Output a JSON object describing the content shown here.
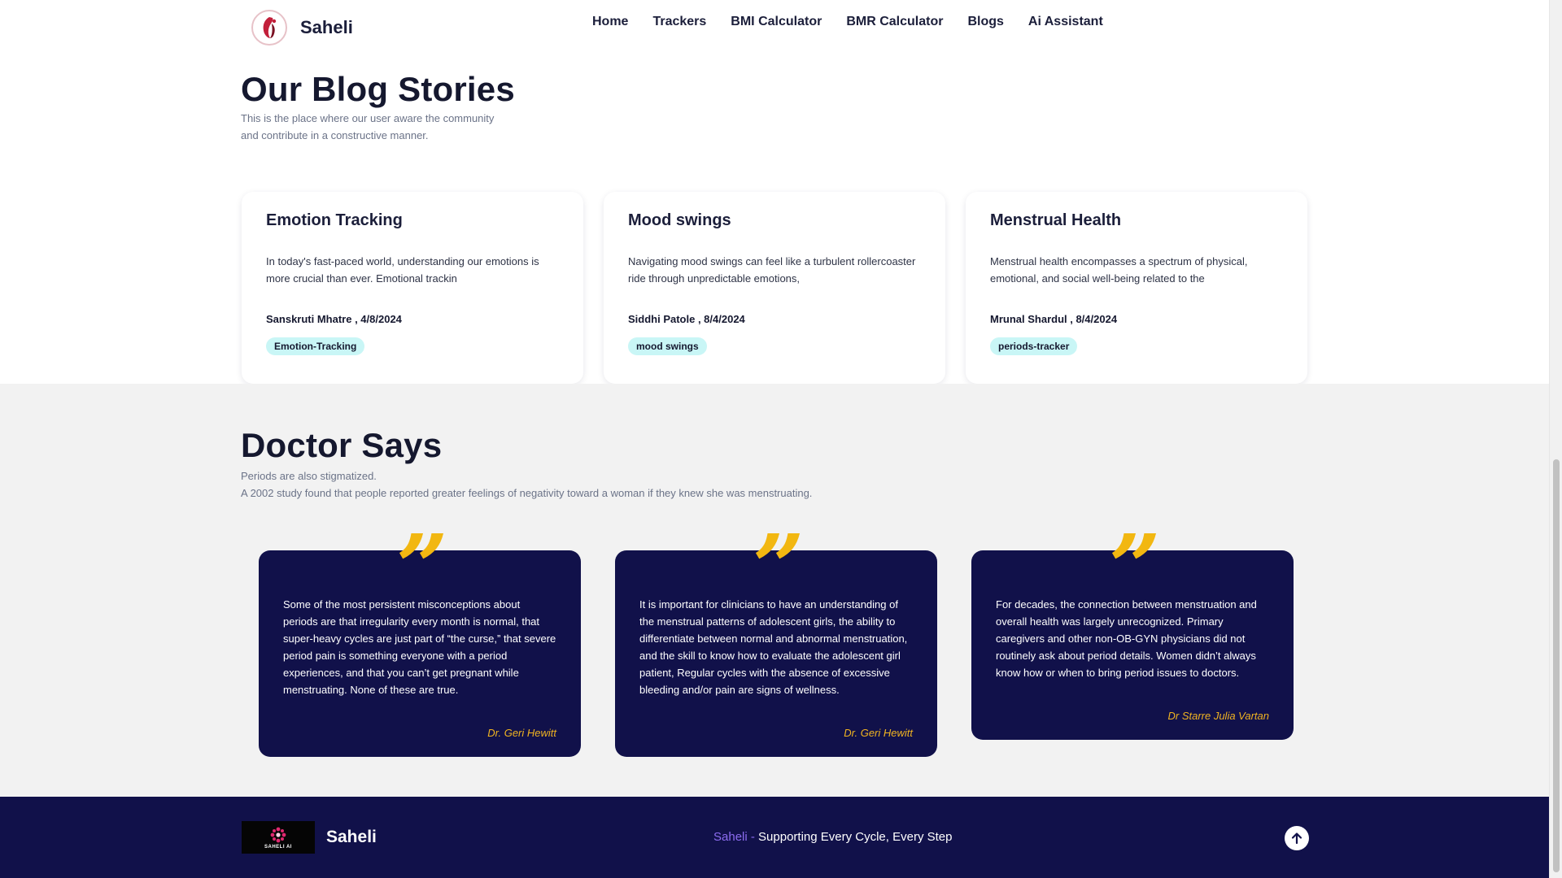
{
  "header": {
    "brand_name": "Saheli",
    "nav": [
      "Home",
      "Trackers",
      "BMI Calculator",
      "BMR Calculator",
      "Blogs",
      "Ai Assistant"
    ]
  },
  "blog": {
    "title": "Our Blog Stories",
    "subtitle": "This is the place where our user aware the community and contribute in a constructive manner.",
    "cards": [
      {
        "title": "Emotion Tracking",
        "excerpt": "In today's fast-paced world, understanding our emotions is more crucial than ever. Emotional trackin",
        "meta": "Sanskruti Mhatre , 4/8/2024",
        "tag": "Emotion-Tracking"
      },
      {
        "title": "Mood swings",
        "excerpt": "Navigating mood swings can feel like a turbulent rollercoaster ride through unpredictable emotions,",
        "meta": "Siddhi Patole , 8/4/2024",
        "tag": "mood swings"
      },
      {
        "title": "Menstrual Health",
        "excerpt": "Menstrual health encompasses a spectrum of physical, emotional, and social well-being related to the",
        "meta": "Mrunal Shardul , 8/4/2024",
        "tag": "periods-tracker"
      }
    ]
  },
  "doctor": {
    "title": "Doctor Says",
    "line1": "Periods are also stigmatized.",
    "line2": "A 2002 study found that people reported greater feelings of negativity toward a woman if they knew she was menstruating.",
    "quote_mark": "”",
    "quotes": [
      {
        "text": "Some of the most persistent misconceptions about periods are that irregularity every month is normal, that super-heavy cycles are just part of “the curse,” that severe period pain is something everyone with a period experiences, and that you can’t get pregnant while menstruating. None of these are true.",
        "author": "Dr. Geri Hewitt"
      },
      {
        "text": "It is important for clinicians to have an understanding of the menstrual patterns of adolescent girls, the ability to differentiate between normal and abnormal menstruation, and the skill to know how to evaluate the adolescent girl patient, Regular cycles with the absence of excessive bleeding and/or pain are signs of wellness.",
        "author": "Dr. Geri Hewitt"
      },
      {
        "text": "For decades, the connection between menstruation and overall health was largely unrecognized. Primary caregivers and other non-OB-GYN physicians did not routinely ask about period details. Women didn’t always know how or when to bring period issues to doctors.",
        "author": "Dr Starre Julia Vartan"
      }
    ]
  },
  "footer": {
    "logo_text": "SAHELI AI",
    "brand_name": "Saheli",
    "tagline_highlight": "Saheli - ",
    "tagline_rest": "Supporting Every Cycle, Every Step",
    "to_top_icon": "arrow-up-icon"
  },
  "colors": {
    "navy": "#11114a",
    "quote_gold": "#f2b711",
    "tag_bg": "#c9f6f6",
    "accent_purple": "#8c6cf0"
  }
}
